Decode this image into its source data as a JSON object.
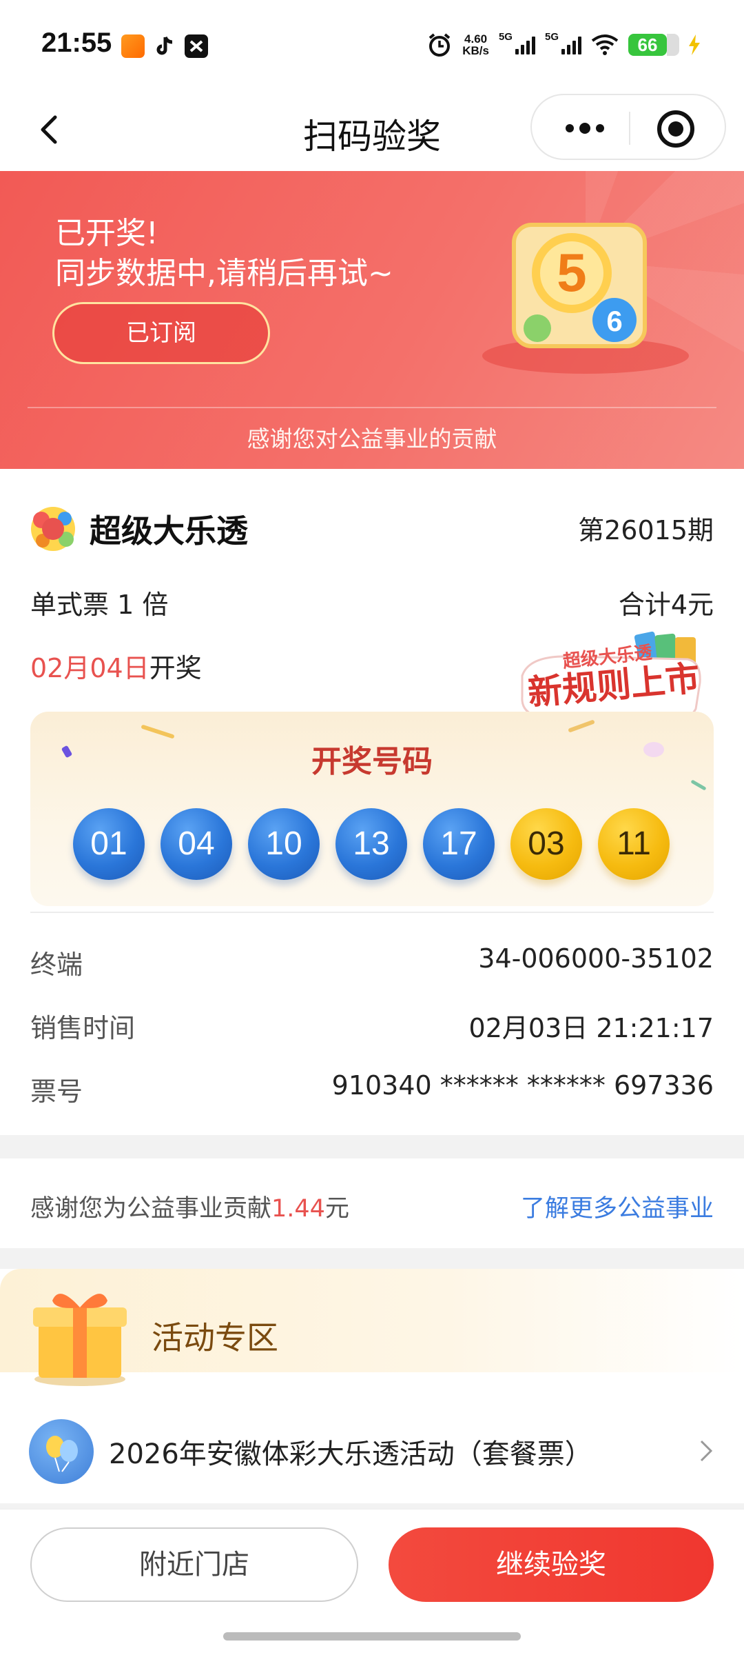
{
  "status_bar": {
    "time": "21:55",
    "network_speed_value": "4.60",
    "network_speed_unit": "KB/s",
    "sim1_label": "5G",
    "sim2_label": "5G",
    "battery_level": "66",
    "icons": [
      "taobao-flash-icon",
      "tiktok-icon",
      "message-icon",
      "alarm-icon",
      "signal-icon",
      "wifi-icon",
      "battery-icon",
      "charging-icon"
    ]
  },
  "nav": {
    "title": "扫码验奖",
    "back_icon": "chevron-left-icon",
    "more_icon": "more-dots-icon",
    "close_icon": "target-close-icon"
  },
  "banner": {
    "title": "已开奖!",
    "subtitle": "同步数据中,请稍后再试~",
    "button_label": "已订阅",
    "footer": "感谢您对公益事业的贡献",
    "illustration_numbers": [
      "5",
      "6"
    ]
  },
  "ticket": {
    "lottery_name": "超级大乐透",
    "issue": "第26015期",
    "ticket_type": "单式票  1 倍",
    "total": "合计4元",
    "draw_date": "02月04日",
    "draw_suffix": "开奖",
    "promo_badge": {
      "small_text": "超级大乐透",
      "big_text": "新规则上市"
    },
    "winning_title": "开奖号码",
    "front_numbers": [
      "01",
      "04",
      "10",
      "13",
      "17"
    ],
    "back_numbers": [
      "03",
      "11"
    ],
    "details": [
      {
        "label": "终端",
        "value": "34-006000-35102"
      },
      {
        "label": "销售时间",
        "value": "02月03日 21:21:17"
      },
      {
        "label": "票号",
        "value": "910340 ****** ****** 697336"
      }
    ]
  },
  "contribution": {
    "text_before": "感谢您为公益事业贡献",
    "amount": "1.44",
    "text_after": "元",
    "link": "了解更多公益事业"
  },
  "activity": {
    "title": "活动专区",
    "items": [
      {
        "text": "2026年安徽体彩大乐透活动（套餐票）"
      }
    ]
  },
  "bottom_bar": {
    "nearby_label": "附近门店",
    "continue_label": "继续验奖"
  },
  "colors": {
    "banner_red": "#f25a55",
    "accent_red": "#e8524f",
    "link_blue": "#3b7ce0",
    "blue_ball": "#2a76d9",
    "yellow_ball": "#f6bb10",
    "primary_button": "#f0372f"
  }
}
